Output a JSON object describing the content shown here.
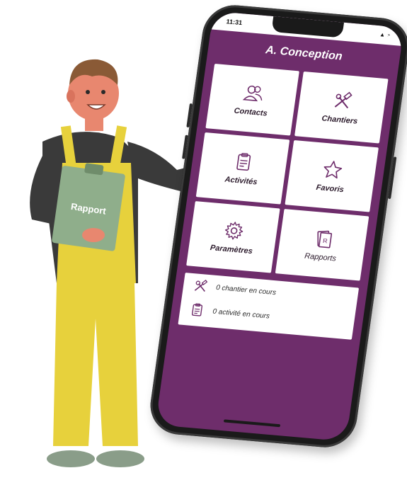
{
  "status_bar": {
    "time": "11:31",
    "icons": "▲ ◔"
  },
  "app": {
    "title": "A. Conception"
  },
  "tiles": [
    {
      "label": "Contacts",
      "icon": "people-icon"
    },
    {
      "label": "Chantiers",
      "icon": "tools-icon"
    },
    {
      "label": "Activités",
      "icon": "clipboard-icon"
    },
    {
      "label": "Favoris",
      "icon": "star-icon"
    },
    {
      "label": "Paramètres",
      "icon": "gear-icon"
    },
    {
      "label": "Rapports",
      "icon": "report-icon"
    }
  ],
  "summary": {
    "chantiers": "0 chantier en cours",
    "activites": "0 activité en cours"
  },
  "illustration": {
    "clipboard_text": "Rapport"
  },
  "colors": {
    "primary": "#6e2d6b",
    "overalls": "#e7d13c",
    "shirt": "#3a3a3a",
    "clipboard": "#8fae8b"
  }
}
